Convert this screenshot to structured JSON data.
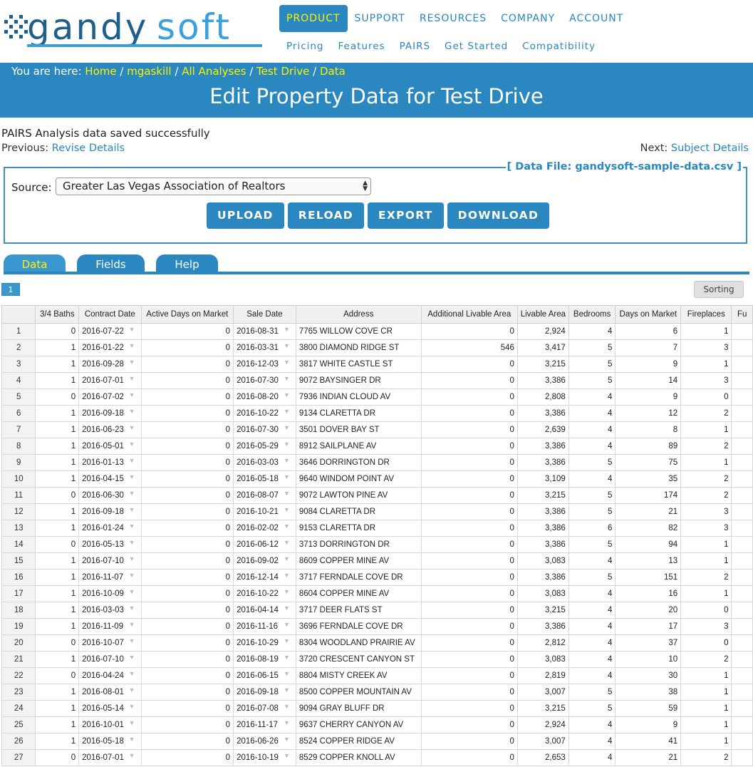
{
  "brand": {
    "logo_text": "gandysoft"
  },
  "nav": {
    "primary": [
      "PRODUCT",
      "SUPPORT",
      "RESOURCES",
      "COMPANY",
      "ACCOUNT"
    ],
    "secondary": [
      "Pricing",
      "Features",
      "PAIRS",
      "Get Started",
      "Compatibility"
    ]
  },
  "breadcrumb": {
    "prefix": "You are here:",
    "items": [
      "Home",
      "mgaskill",
      "All Analyses",
      "Test Drive",
      "Data"
    ]
  },
  "page_title": "Edit Property Data for Test Drive",
  "status_message": "PAIRS Analysis data saved successfully",
  "prev": {
    "label": "Previous:",
    "link": "Revise Details"
  },
  "next": {
    "label": "Next:",
    "link": "Subject Details"
  },
  "datafile": {
    "legend": "[ Data File: gandysoft-sample-data.csv ]",
    "source_label": "Source:",
    "source_value": "Greater Las Vegas Association of Realtors",
    "buttons": [
      "UPLOAD",
      "RELOAD",
      "EXPORT",
      "DOWNLOAD"
    ]
  },
  "tabs": [
    "Data",
    "Fields",
    "Help"
  ],
  "pager": {
    "page": "1"
  },
  "sorting_label": "Sorting",
  "table": {
    "columns": [
      "",
      "3/4 Baths",
      "Contract Date",
      "Active Days on Market",
      "Sale Date",
      "Address",
      "Additional Livable Area",
      "Livable Area",
      "Bedrooms",
      "Days on Market",
      "Fireplaces",
      "Fu"
    ],
    "rows": [
      [
        "1",
        "0",
        "2016-07-22",
        "0",
        "2016-08-31",
        "7765 WILLOW COVE CR",
        "0",
        "2,924",
        "4",
        "6",
        "1"
      ],
      [
        "2",
        "1",
        "2016-01-22",
        "0",
        "2016-03-31",
        "3800 DIAMOND RIDGE ST",
        "546",
        "3,417",
        "5",
        "7",
        "3"
      ],
      [
        "3",
        "1",
        "2016-09-28",
        "0",
        "2016-12-03",
        "3817 WHITE CASTLE ST",
        "0",
        "3,215",
        "5",
        "9",
        "1"
      ],
      [
        "4",
        "1",
        "2016-07-01",
        "0",
        "2016-07-30",
        "9072 BAYSINGER DR",
        "0",
        "3,386",
        "5",
        "14",
        "3"
      ],
      [
        "5",
        "0",
        "2016-07-02",
        "0",
        "2016-08-20",
        "7936 INDIAN CLOUD AV",
        "0",
        "2,808",
        "4",
        "9",
        "0"
      ],
      [
        "6",
        "1",
        "2016-09-18",
        "0",
        "2016-10-22",
        "9134 CLARETTA DR",
        "0",
        "3,386",
        "4",
        "12",
        "2"
      ],
      [
        "7",
        "1",
        "2016-06-23",
        "0",
        "2016-07-30",
        "3501 DOVER BAY ST",
        "0",
        "2,639",
        "4",
        "8",
        "1"
      ],
      [
        "8",
        "1",
        "2016-05-01",
        "0",
        "2016-05-29",
        "8912 SAILPLANE AV",
        "0",
        "3,386",
        "4",
        "89",
        "2"
      ],
      [
        "9",
        "1",
        "2016-01-13",
        "0",
        "2016-03-03",
        "3646 DORRINGTON DR",
        "0",
        "3,386",
        "5",
        "75",
        "1"
      ],
      [
        "10",
        "1",
        "2016-04-15",
        "0",
        "2016-05-18",
        "9640 WINDOM POINT AV",
        "0",
        "3,109",
        "4",
        "35",
        "2"
      ],
      [
        "11",
        "0",
        "2016-06-30",
        "0",
        "2016-08-07",
        "9072 LAWTON PINE AV",
        "0",
        "3,215",
        "5",
        "174",
        "2"
      ],
      [
        "12",
        "1",
        "2016-09-18",
        "0",
        "2016-10-21",
        "9084 CLARETTA DR",
        "0",
        "3,386",
        "5",
        "21",
        "3"
      ],
      [
        "13",
        "1",
        "2016-01-24",
        "0",
        "2016-02-02",
        "9153 CLARETTA DR",
        "0",
        "3,386",
        "6",
        "82",
        "3"
      ],
      [
        "14",
        "0",
        "2016-05-13",
        "0",
        "2016-06-12",
        "3713 DORRINGTON DR",
        "0",
        "3,386",
        "5",
        "94",
        "1"
      ],
      [
        "15",
        "1",
        "2016-07-10",
        "0",
        "2016-09-02",
        "8609 COPPER MINE AV",
        "0",
        "3,083",
        "4",
        "13",
        "1"
      ],
      [
        "16",
        "1",
        "2016-11-07",
        "0",
        "2016-12-14",
        "3717 FERNDALE COVE DR",
        "0",
        "3,386",
        "5",
        "151",
        "2"
      ],
      [
        "17",
        "1",
        "2016-10-09",
        "0",
        "2016-10-22",
        "8604 COPPER MINE AV",
        "0",
        "3,083",
        "4",
        "16",
        "1"
      ],
      [
        "18",
        "1",
        "2016-03-03",
        "0",
        "2016-04-14",
        "3717 DEER FLATS ST",
        "0",
        "3,215",
        "4",
        "20",
        "0"
      ],
      [
        "19",
        "1",
        "2016-11-09",
        "0",
        "2016-11-16",
        "3696 FERNDALE COVE DR",
        "0",
        "3,386",
        "4",
        "17",
        "3"
      ],
      [
        "20",
        "0",
        "2016-10-07",
        "0",
        "2016-10-29",
        "8304 WOODLAND PRAIRIE AV",
        "0",
        "2,812",
        "4",
        "37",
        "0"
      ],
      [
        "21",
        "1",
        "2016-07-10",
        "0",
        "2016-08-19",
        "3720 CRESCENT CANYON ST",
        "0",
        "3,083",
        "4",
        "10",
        "2"
      ],
      [
        "22",
        "0",
        "2016-04-24",
        "0",
        "2016-06-15",
        "8804 MISTY CREEK AV",
        "0",
        "2,819",
        "4",
        "30",
        "1"
      ],
      [
        "23",
        "1",
        "2016-08-01",
        "0",
        "2016-09-18",
        "8500 COPPER MOUNTAIN AV",
        "0",
        "3,007",
        "5",
        "38",
        "1"
      ],
      [
        "24",
        "1",
        "2016-05-14",
        "0",
        "2016-07-08",
        "9094 GRAY BLUFF DR",
        "0",
        "3,215",
        "5",
        "59",
        "1"
      ],
      [
        "25",
        "1",
        "2016-10-01",
        "0",
        "2016-11-17",
        "9637 CHERRY CANYON AV",
        "0",
        "2,924",
        "4",
        "9",
        "1"
      ],
      [
        "26",
        "1",
        "2016-05-18",
        "0",
        "2016-06-26",
        "8524 COPPER RIDGE AV",
        "0",
        "3,007",
        "4",
        "41",
        "1"
      ],
      [
        "27",
        "0",
        "2016-07-01",
        "0",
        "2016-10-19",
        "8529 COPPER KNOLL AV",
        "0",
        "2,653",
        "4",
        "21",
        "2"
      ]
    ]
  },
  "colors": {
    "brand_blue": "#2a87c0",
    "active_yellow": "#fff200"
  }
}
